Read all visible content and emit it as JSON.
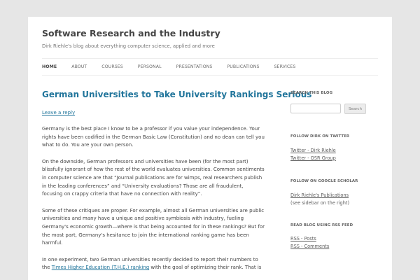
{
  "site": {
    "title": "Software Research and the Industry",
    "description": "Dirk Riehle's blog about everything computer science, applied and more"
  },
  "nav": {
    "items": [
      "HOME",
      "ABOUT",
      "COURSES",
      "PERSONAL",
      "PRESENTATIONS",
      "PUBLICATIONS",
      "SERVICES"
    ],
    "active": "HOME"
  },
  "post": {
    "title": "German Universities to Take University Rankings Serious",
    "reply_link": "Leave a reply",
    "p1": "Germany is the best place I know to be a professor if you value your independence. Your rights have been codified in the German Basic Law (Constitution) and no dean can tell you what to do. You are your own person.",
    "p2": "On the downside, German professors and universities have been (for the most part) blissfully ignorant of how the rest of the world evaluates universities. Common sentiments in computer science are that “Journal publications are for wimps, real researchers publish in the leading conferences” and “University evaluations? Those are all fraudulent, focusing on crappy criteria that have no connection with reality”.",
    "p3": "Some of these critiques are proper. For example, almost all German universities are public universities and many have a unique and positive symbiosis with industry, fueling Germany's economic growth—where is that being accounted for in these rankings? But for the most part, Germany's hesitance to join the international ranking game has been harmful.",
    "p4_before": "In one experiment, two German universities recently decided to report their numbers to the ",
    "p4_link": "Times Higher Education (T.H.E.) ranking",
    "p4_after": " with the goal of optimizing their rank. That is"
  },
  "sidebar": {
    "search": {
      "title": "SEARCH THIS BLOG",
      "button": "Search",
      "placeholder": ""
    },
    "twitter": {
      "title": "FOLLOW DIRK ON TWITTER",
      "links": [
        "Twitter - Dirk Riehle",
        "Twitter - OSR Group"
      ]
    },
    "scholar": {
      "title": "FOLLOW ON GOOGLE SCHOLAR",
      "link": "Dirk Riehle's Publications",
      "note": "(see sidebar on the right)"
    },
    "rss": {
      "title": "READ BLOG USING RSS FEED",
      "links": [
        "RSS - Posts",
        "RSS - Comments"
      ]
    }
  }
}
